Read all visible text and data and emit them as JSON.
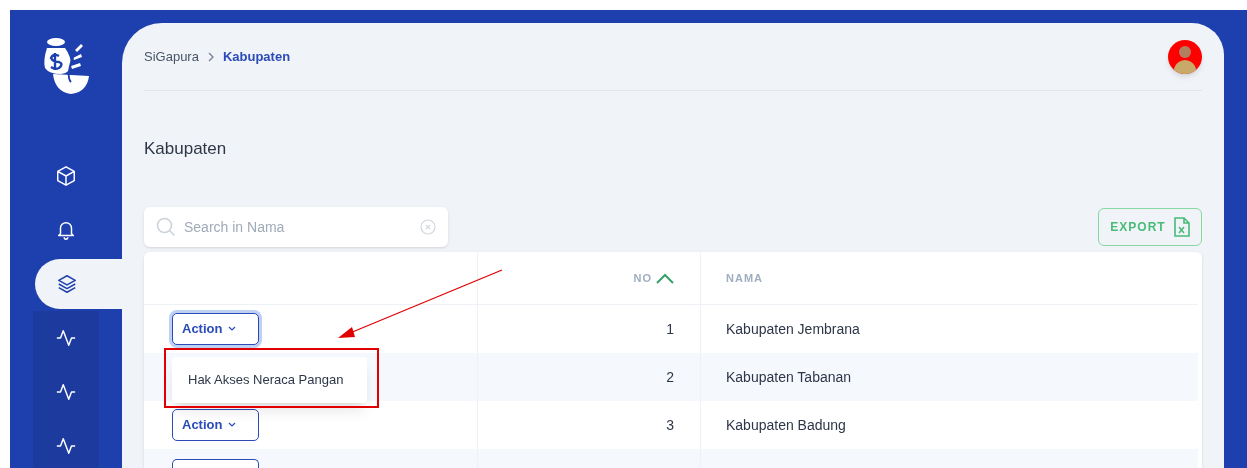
{
  "sidebar": {
    "items": [
      {
        "kind": "cube",
        "selected": false
      },
      {
        "kind": "bell",
        "selected": false
      },
      {
        "kind": "layers",
        "selected": true
      },
      {
        "kind": "activity",
        "selected": false
      },
      {
        "kind": "activity",
        "selected": false
      },
      {
        "kind": "activity",
        "selected": false
      }
    ]
  },
  "breadcrumb": [
    {
      "label": "SiGapura",
      "current": false
    },
    {
      "label": "Kabupaten",
      "current": true
    }
  ],
  "page_title": "Kabupaten",
  "search": {
    "placeholder": "Search in Nama"
  },
  "export_button": {
    "label": "EXPORT"
  },
  "table": {
    "columns": [
      {
        "label": "NO",
        "sorted_ascending": true
      },
      {
        "label": "NAMA",
        "sorted_ascending": false
      }
    ],
    "rows": [
      {
        "action": "Action",
        "action_focused": true,
        "no": "1",
        "nama": "Kabupaten Jembrana"
      },
      {
        "no": "2",
        "nama": "Kabupaten Tabanan"
      },
      {
        "action": "Action",
        "action_focused": false,
        "no": "3",
        "nama": "Kabupaten Badung"
      },
      {
        "cut_off": true
      }
    ]
  },
  "action_menu": {
    "open": true,
    "items": [
      "Hak Akses Neraca Pangan"
    ]
  },
  "annotation": {
    "kind": "box-and-arrow"
  }
}
